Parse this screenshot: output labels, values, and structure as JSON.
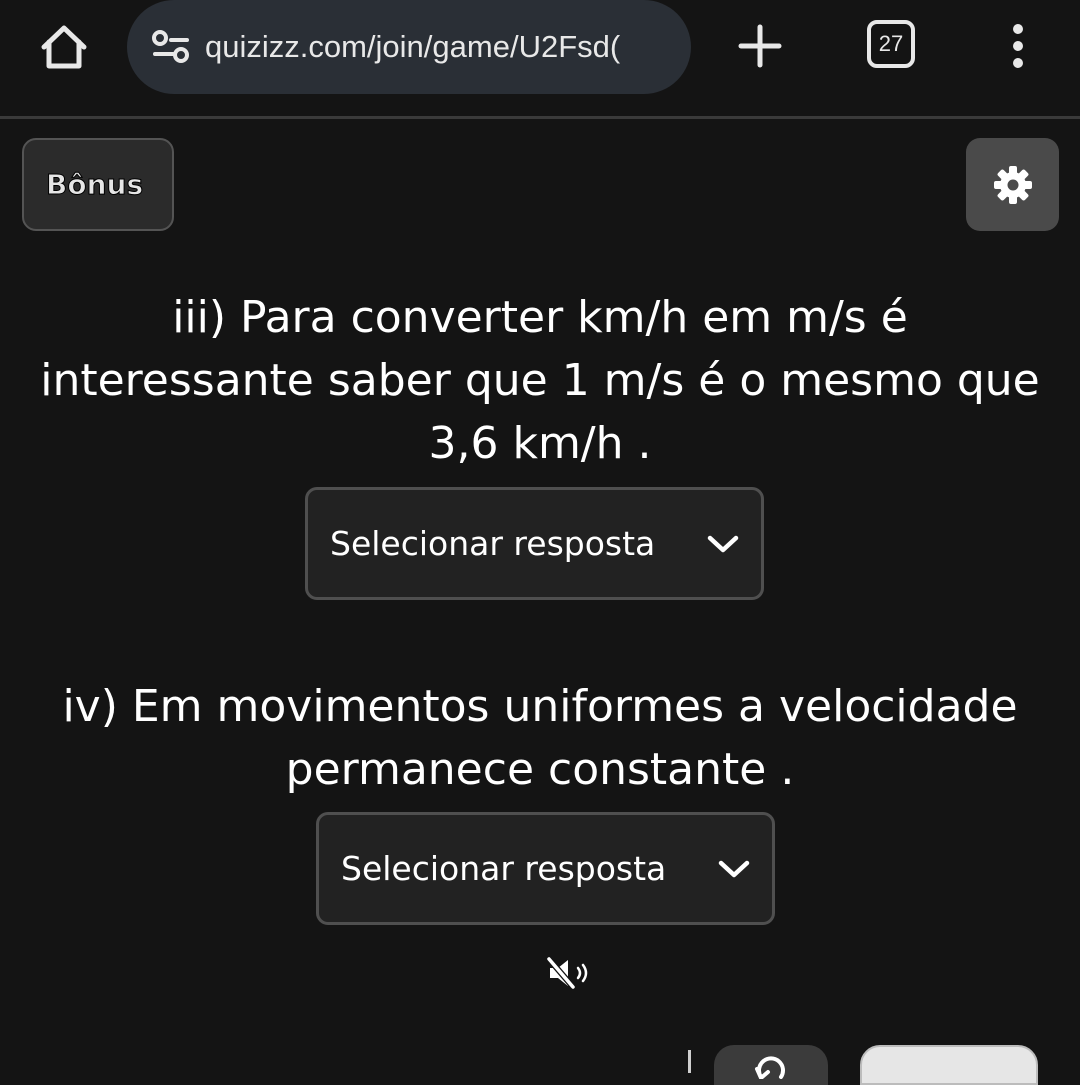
{
  "browser": {
    "url": "quizizz.com/join/game/U2Fsd(",
    "tab_count": "27",
    "icons": {
      "home": "home-icon",
      "site_info": "site-settings-icon",
      "new_tab": "plus-icon",
      "menu": "more-vertical-icon"
    }
  },
  "quiz": {
    "bonus_label": "Bônus",
    "settings_icon": "gear-icon",
    "questions": [
      {
        "text": "iii) Para converter km/h em m/s é interessante saber que 1 m/s é o mesmo que 3,6 km/h .",
        "select_label": "Selecionar resposta"
      },
      {
        "text": "iv) Em movimentos uniformes a velocidade permanece constante .",
        "select_label": "Selecionar resposta"
      }
    ],
    "mute_icon": "volume-muted-icon",
    "bottom_buttons": [
      "redo-icon"
    ]
  },
  "colors": {
    "background": "#141414",
    "url_bar": "#2a2f36",
    "select_bg": "#222222",
    "select_border": "#4f4f4f",
    "settings_bg": "#4a4a4a"
  }
}
